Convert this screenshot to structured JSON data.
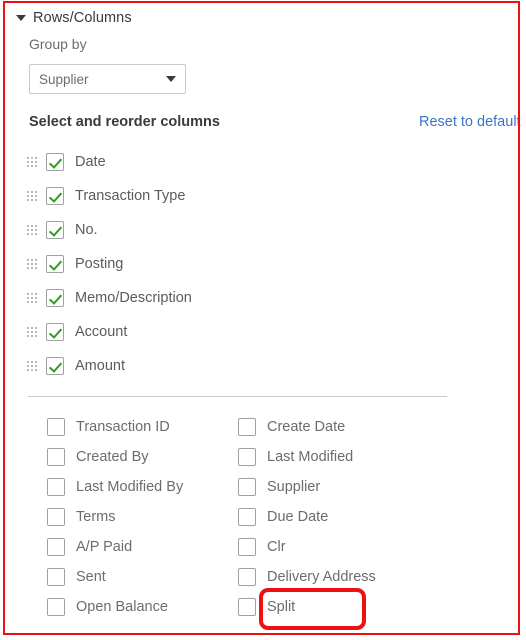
{
  "panel": {
    "section_title": "Rows/Columns",
    "caret_icon": "caret-down-icon",
    "group_by_label": "Group by",
    "dropdown": {
      "value": "Supplier",
      "caret_icon": "chevron-down-icon"
    },
    "reorder_heading": "Select and reorder columns",
    "reset_link": "Reset to default"
  },
  "selected_columns": [
    {
      "label": "Date",
      "checked": true,
      "handle_icon": "drag-handle-icon"
    },
    {
      "label": "Transaction Type",
      "checked": true,
      "handle_icon": "drag-handle-icon"
    },
    {
      "label": "No.",
      "checked": true,
      "handle_icon": "drag-handle-icon"
    },
    {
      "label": "Posting",
      "checked": true,
      "handle_icon": "drag-handle-icon"
    },
    {
      "label": "Memo/Description",
      "checked": true,
      "handle_icon": "drag-handle-icon"
    },
    {
      "label": "Account",
      "checked": true,
      "handle_icon": "drag-handle-icon"
    },
    {
      "label": "Amount",
      "checked": true,
      "handle_icon": "drag-handle-icon"
    }
  ],
  "available_columns": {
    "rows": [
      {
        "left": "Transaction ID",
        "right": "Create Date"
      },
      {
        "left": "Created By",
        "right": "Last Modified"
      },
      {
        "left": "Last Modified By",
        "right": "Supplier"
      },
      {
        "left": "Terms",
        "right": "Due Date"
      },
      {
        "left": "A/P Paid",
        "right": "Clr"
      },
      {
        "left": "Sent",
        "right": "Delivery Address"
      },
      {
        "left": "Open Balance",
        "right": "Split"
      }
    ]
  },
  "annotations": {
    "highlight_target": "Split",
    "highlight_color": "#ee1111",
    "border_color": "#ee1111"
  },
  "colors": {
    "checkmark_green": "#2ca01c",
    "link_blue": "#3a74c8",
    "text_dark": "#393a3d",
    "text_muted": "#6b6c72"
  }
}
